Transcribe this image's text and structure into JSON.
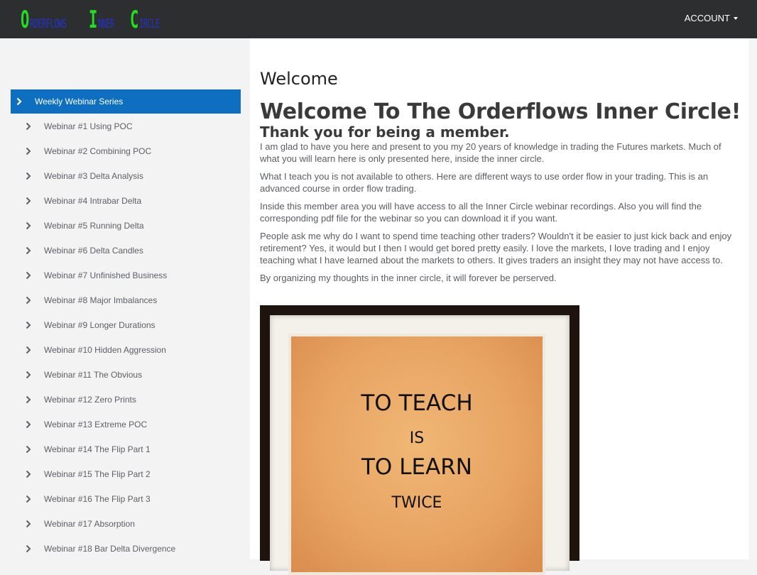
{
  "brand": {
    "words": [
      {
        "initial": "O",
        "rest": "RDERFLOWS"
      },
      {
        "initial": "I",
        "rest": "NNER"
      },
      {
        "initial": "C",
        "rest": "IRCLE"
      }
    ],
    "colors": {
      "initial": "#22dd22",
      "rest": "#2233cc"
    }
  },
  "header": {
    "account_label": "ACCOUNT"
  },
  "sidebar": {
    "section_label": "Weekly Webinar Series",
    "items": [
      "Webinar #1 Using POC",
      "Webinar #2 Combining POC",
      "Webinar #3 Delta Analysis",
      "Webinar #4 Intrabar Delta",
      "Webinar #5 Running Delta",
      "Webinar #6 Delta Candles",
      "Webinar #7 Unfinished Business",
      "Webinar #8 Major Imbalances",
      "Webinar #9 Longer Durations",
      "Webinar #10 Hidden Aggression",
      "Webinar #11 The Obvious",
      "Webinar #12 Zero Prints",
      "Webinar #13 Extreme POC",
      "Webinar #14 The Flip Part 1",
      "Webinar #15 The Flip Part 2",
      "Webinar #16 The Flip Part 3",
      "Webinar #17 Absorption",
      "Webinar #18 Bar Delta Divergence"
    ],
    "active_color": "#0e6fc0"
  },
  "main": {
    "page_title": "Welcome",
    "heading": "Welcome To The Orderflows Inner Circle!",
    "subheading": "Thank you for being a member.",
    "paragraphs": [
      "I am glad to have you here and present to you my 20 years of knowledge in trading the Futures markets. Much of what you will learn here is only presented here, inside the inner circle.",
      "What I teach you is not available to others. Here are different ways to use order flow in your trading. This is an advanced course in order flow trading.",
      "Inside this member area you will have access to all the Inner Circle webinar recordings. Also you will find the corresponding pdf file for the webinar so you can download it if you want.",
      "People ask me why do I want to spend time teaching other traders? Wouldn't it be easier to just kick back and enjoy retirement? Yes, it would but I then I would get bored pretty easily. I love the markets, I love trading and I enjoy teaching what I have learned about the markets to others. It gives traders an insight they may not have access to.",
      "By organizing my thoughts in the inner circle, it will forever be perserved."
    ],
    "poster_lines": [
      "TO TEACH",
      "IS",
      "TO LEARN",
      "TWICE"
    ]
  }
}
